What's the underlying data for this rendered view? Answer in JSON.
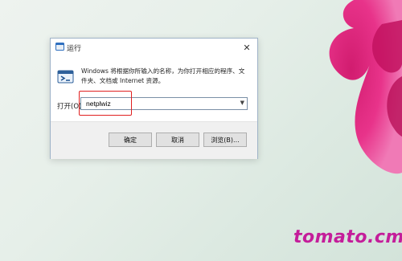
{
  "dialog": {
    "title": "运行",
    "description": "Windows 将根据你所输入的名称，为你打开相应的程序、文件夹、文档或 Internet 资源。",
    "open_label": "打开(O):",
    "command_value": "netplwiz",
    "buttons": {
      "ok": "确定",
      "cancel": "取消",
      "browse": "浏览(B)..."
    },
    "close_glyph": "✕"
  },
  "watermark": {
    "text": "tomato.cm",
    "color": "#c41d9a"
  },
  "icons": [
    "run-icon",
    "close-icon",
    "chevron-down-icon"
  ],
  "colors": {
    "highlight": "#e02020",
    "dialog_footer": "#f0f0f0"
  }
}
